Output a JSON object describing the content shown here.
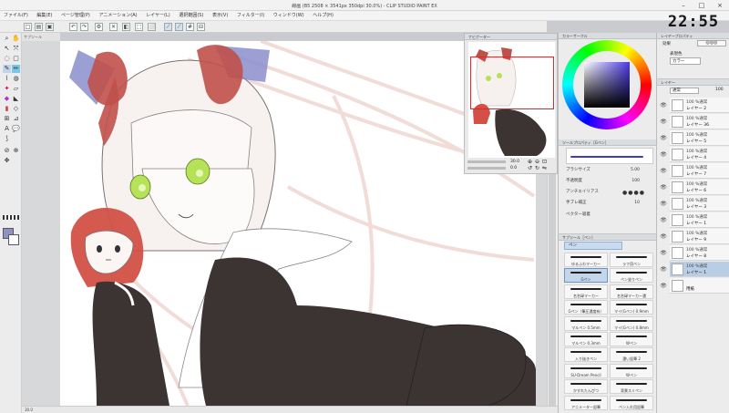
{
  "window": {
    "title": "線画 (B5 2508 × 3541px 350dpi 30.0%) - CLIP STUDIO PAINT EX",
    "clock": "22:55"
  },
  "menu": [
    "ファイル(F)",
    "編集(E)",
    "ページ管理(P)",
    "アニメーション(A)",
    "レイヤー(L)",
    "選択範囲(S)",
    "表示(V)",
    "フィルター(I)",
    "ウィンドウ(W)",
    "ヘルプ(H)"
  ],
  "toolbar": {
    "subtool_label": "サブツール"
  },
  "navigator": {
    "title": "ナビゲーター",
    "zoom": "30.0",
    "angle": "0.0"
  },
  "color_panel": {
    "title": "カラーサークル"
  },
  "brush_props": {
    "title": "ツールプロパティ［Gペン］",
    "size_label": "ブラシサイズ",
    "size_value": "5.00",
    "opacity_label": "不透明度",
    "opacity_value": "100",
    "aa_label": "アンチエイリアス",
    "stabilize_label": "手ブレ補正",
    "stabilize_value": "10",
    "vector_label": "ベクター吸着"
  },
  "subtool": {
    "title": "サブツール［ペン］",
    "group": "ペン",
    "brushes": [
      "ゆるふわマーカー",
      "ラフ用ペン",
      "Gペン",
      "ペン塗りペン",
      "名名碌マーカー",
      "名名碌マーカー濃",
      "Gペン（筆圧濃度有）",
      "マイ(Gペン) 0.9mm",
      "マルペン 0.5mm",
      "マイ(Gペン) 0.8mm",
      "マルペン 0.3mm",
      "Wペン",
      "入り抜きペン",
      "濃い鉛筆 2",
      "SU-Dream Pencil",
      "Wペン",
      "かすれたんぴつ",
      "背景スミペン",
      "アニメーター鉛筆",
      "ペン入れ用鉛筆"
    ]
  },
  "layer_property": {
    "title": "レイヤープロパティ",
    "effect_label": "効果",
    "color_label": "表現色",
    "color_value": "カラー"
  },
  "layers": {
    "title": "レイヤー",
    "blend": "通常",
    "opacity": "100",
    "items": [
      {
        "meta": "100 %通常",
        "name": "レイヤー 2"
      },
      {
        "meta": "100 %通常",
        "name": "レイヤー 36"
      },
      {
        "meta": "100 %通常",
        "name": "レイヤー 5"
      },
      {
        "meta": "100 %通常",
        "name": "レイヤー 4"
      },
      {
        "meta": "100 %通常",
        "name": "レイヤー 7"
      },
      {
        "meta": "100 %通常",
        "name": "レイヤー 6"
      },
      {
        "meta": "100 %通常",
        "name": "レイヤー 3"
      },
      {
        "meta": "100 %通常",
        "name": "レイヤー 1"
      },
      {
        "meta": "100 %通常",
        "name": "レイヤー 9"
      },
      {
        "meta": "100 %通常",
        "name": "レイヤー 8"
      },
      {
        "meta": "100 %通常",
        "name": "レイヤー 1"
      },
      {
        "meta": "",
        "name": "用紙"
      }
    ]
  },
  "status": {
    "zoom": "30.0"
  },
  "colors": {
    "accent": "#8fb1d6",
    "ribbon": "#b8453f",
    "dress": "#3b3432",
    "eyes": "#a6d84a"
  }
}
